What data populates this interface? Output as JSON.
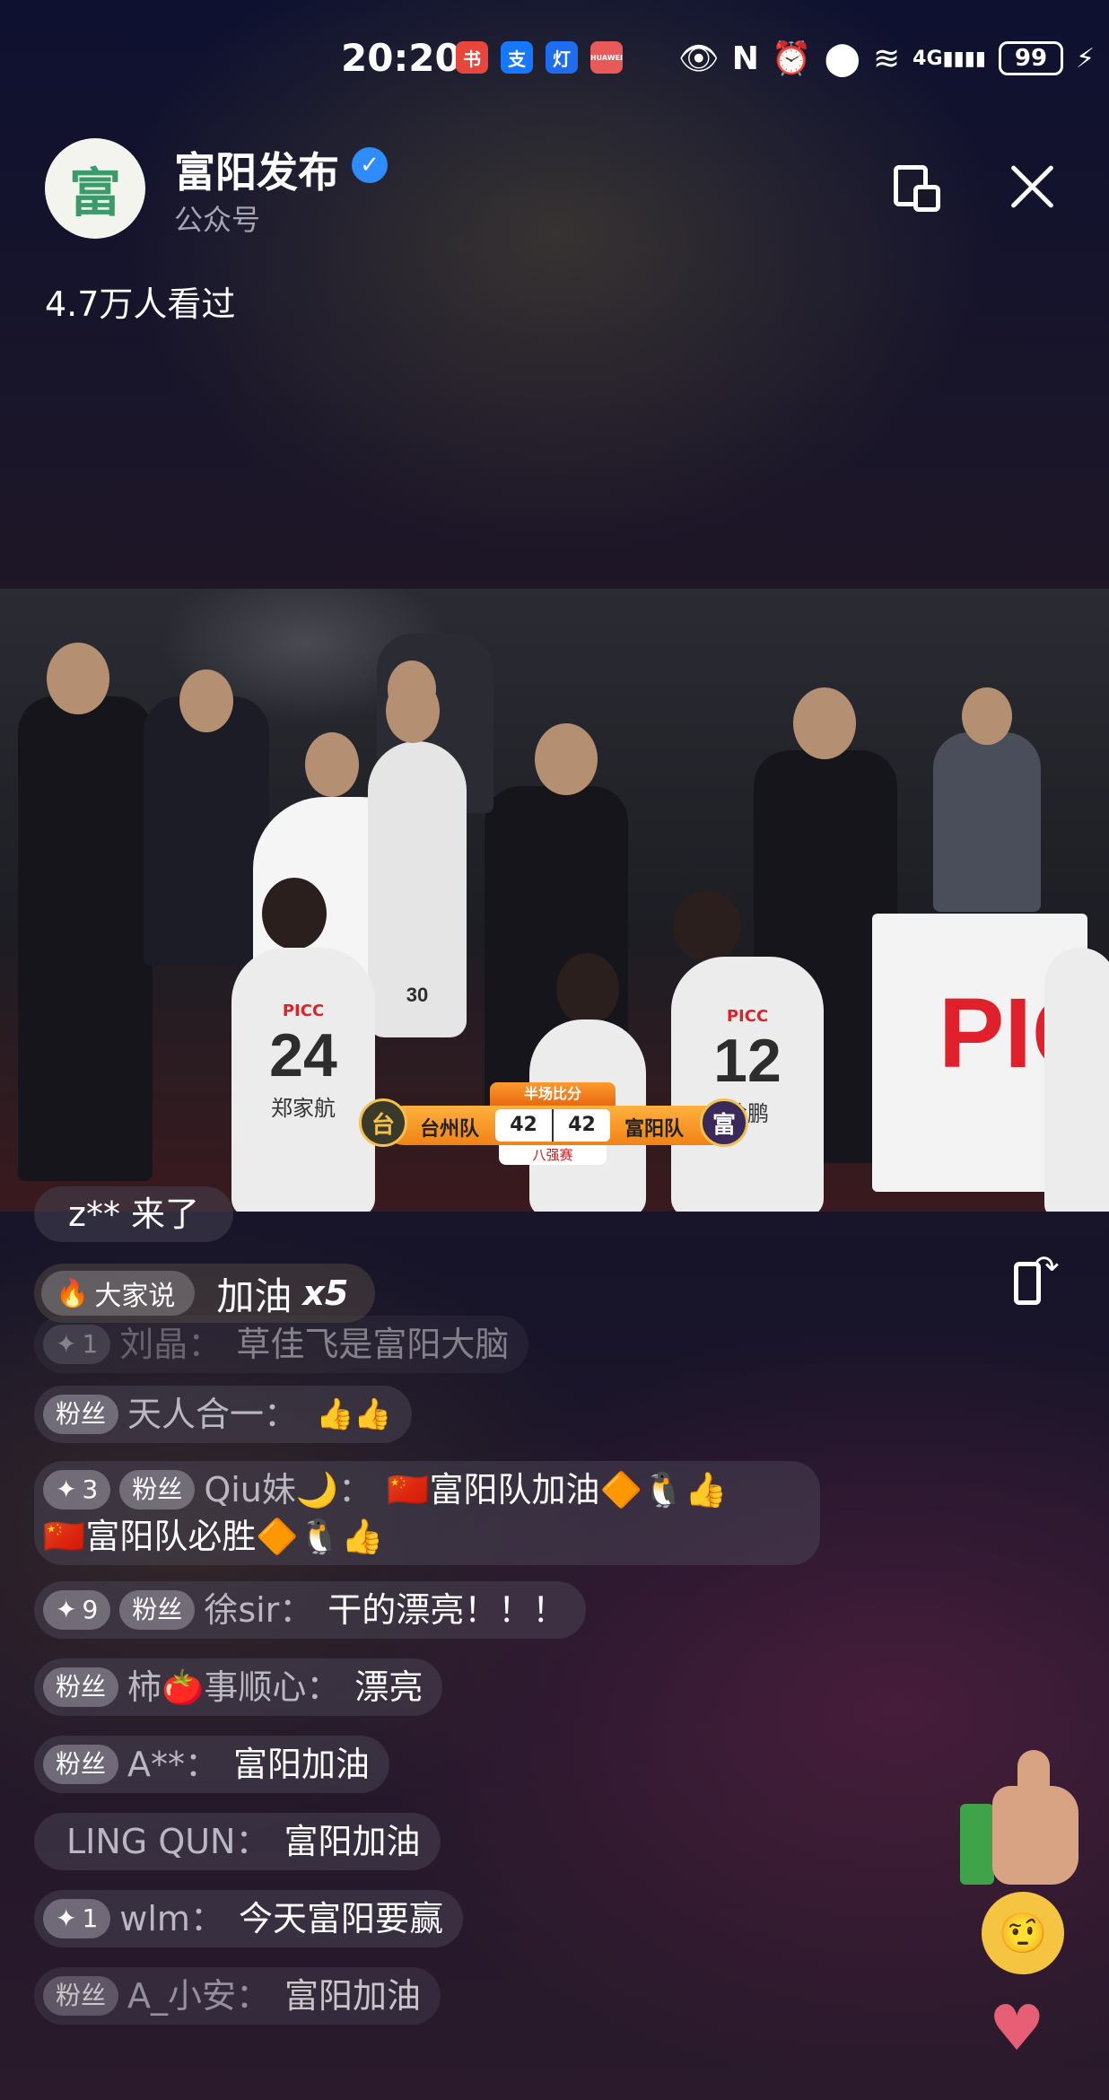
{
  "status_bar": {
    "time": "20:20",
    "app_badges": [
      "书",
      "支",
      "灯",
      "HUAWEI"
    ],
    "network": "4G",
    "battery": "99"
  },
  "header": {
    "account_name": "富阳发布",
    "account_type": "公众号",
    "avatar_text": "富",
    "viewers": "4.7万人看过"
  },
  "scoreboard": {
    "title": "半场比分",
    "home_team": "台州队",
    "home_score": "42",
    "away_team": "富阳队",
    "away_score": "42",
    "round": "八强赛"
  },
  "video_overlay": {
    "banner_text": "PIC",
    "player1_number": "24",
    "player1_name": "郑家航",
    "player2_number": "12",
    "player2_name": "徐鹏",
    "jersey_text": "PICC"
  },
  "chat": {
    "join_notice": "z** 来了",
    "hot_tag": "大家说",
    "hot_text": "加油",
    "hot_count": "x5",
    "messages": [
      {
        "level": "1",
        "badge": "",
        "user": "刘晶：",
        "text": "草佳飞是富阳大脑",
        "emoji": ""
      },
      {
        "level": "",
        "badge": "粉丝",
        "user": "天人合一：",
        "text": "",
        "emoji": "👍👍"
      },
      {
        "level": "3",
        "badge": "粉丝",
        "user": "Qiu妹🌙：",
        "text": "🇨🇳富阳队加油🔶🐧👍",
        "text2": "🇨🇳富阳队必胜🔶🐧👍",
        "emoji": ""
      },
      {
        "level": "9",
        "badge": "粉丝",
        "user": "徐sir：",
        "text": "干的漂亮！！！",
        "emoji": ""
      },
      {
        "level": "",
        "badge": "粉丝",
        "user": "柿🍅事顺心：",
        "text": "漂亮",
        "emoji": ""
      },
      {
        "level": "",
        "badge": "粉丝",
        "user": "A**：",
        "text": "富阳加油",
        "emoji": ""
      },
      {
        "level": "",
        "badge": "",
        "user": "LING QUN：",
        "text": "富阳加油",
        "emoji": ""
      },
      {
        "level": "1",
        "badge": "",
        "user": "wlm：",
        "text": "今天富阳要赢",
        "emoji": ""
      },
      {
        "level": "",
        "badge": "粉丝",
        "user": "A_小安：",
        "text": "富阳加油",
        "emoji": ""
      }
    ]
  },
  "colors": {
    "accent_blue": "#2f8cff",
    "heart": "#e65f74",
    "score_orange": "#f08216"
  }
}
